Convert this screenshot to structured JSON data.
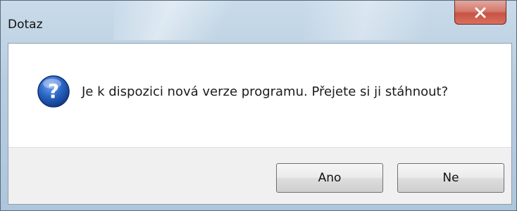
{
  "window": {
    "title": "Dotaz"
  },
  "dialog": {
    "icon": "question-icon",
    "message": "Je k dispozici nová verze programu. Přejete si ji stáhnout?"
  },
  "buttons": {
    "yes_label": "Ano",
    "no_label": "Ne"
  },
  "colors": {
    "titlebar": "#b7cde0",
    "close_button": "#c75343",
    "icon_blue": "#1f5bb5",
    "footer": "#f0f0f0"
  }
}
